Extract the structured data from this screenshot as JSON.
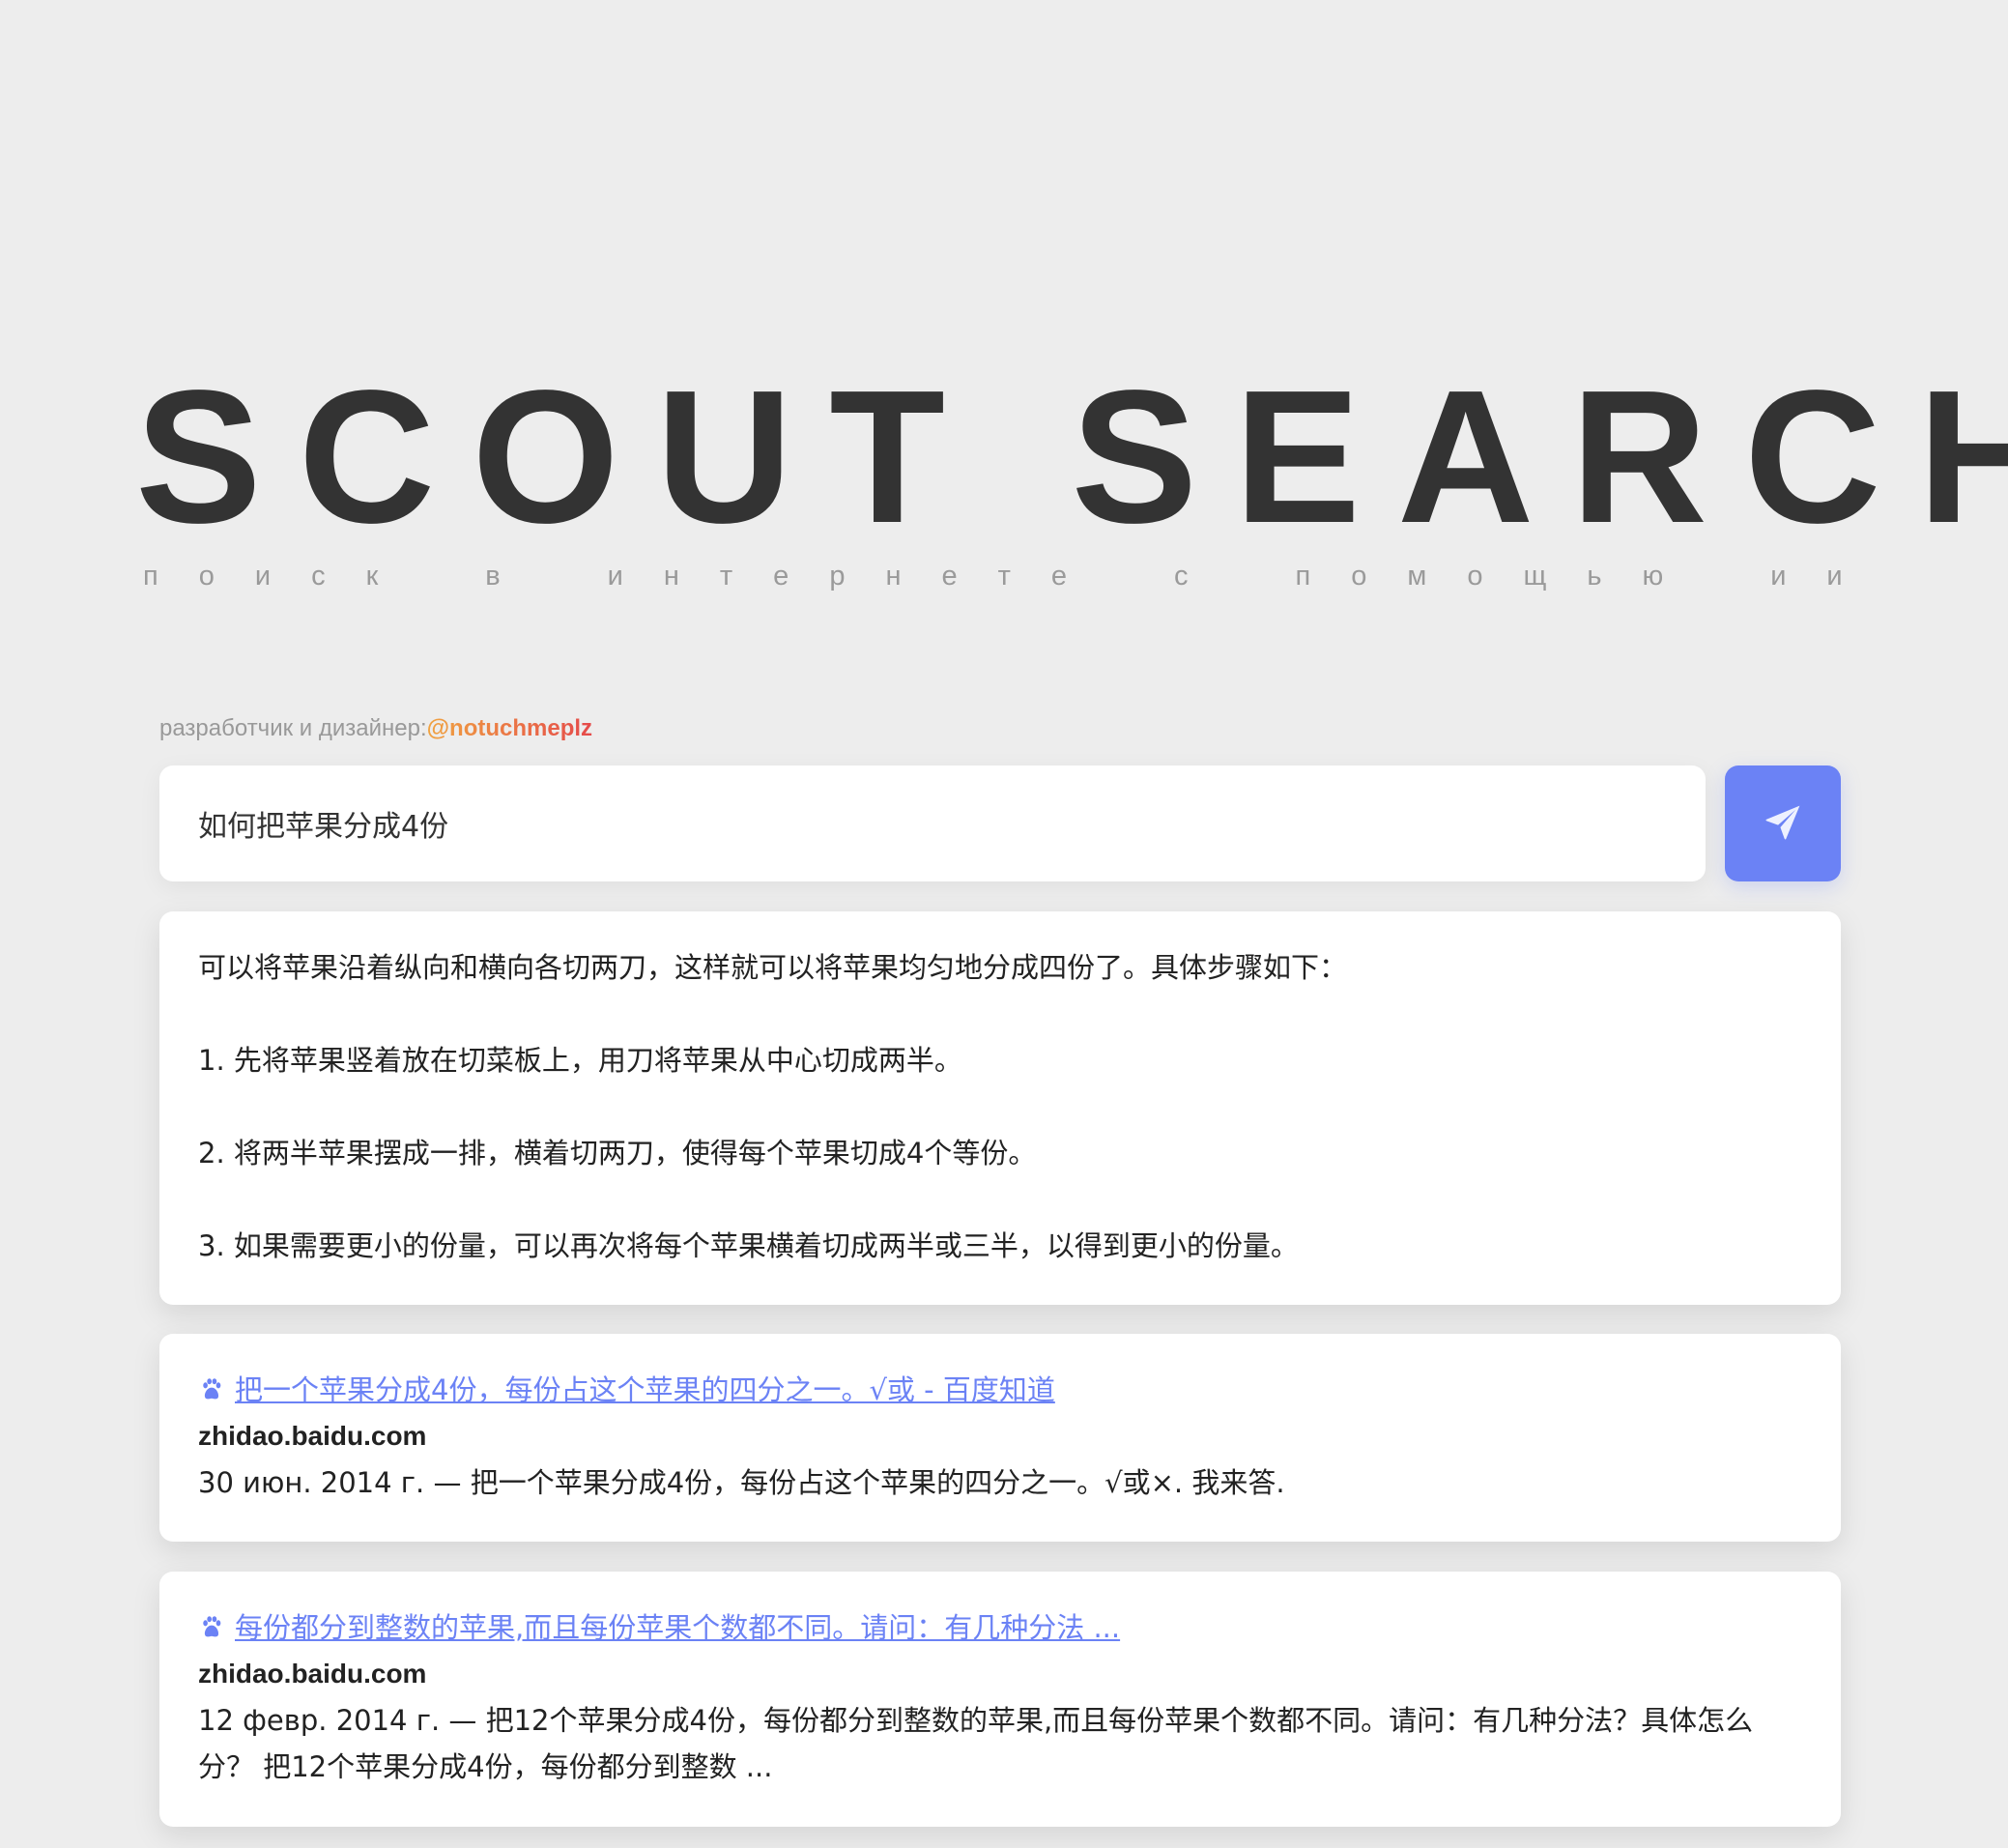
{
  "app": {
    "title": "SCOUT SEARCH",
    "subtitle_words": [
      "поиск",
      "в",
      "интернете",
      "с",
      "помощью",
      "ии"
    ]
  },
  "credit": {
    "label": "разработчик и дизайнер:",
    "handle": "@notuchmeplz"
  },
  "search": {
    "value": "如何把苹果分成4份",
    "placeholder": "",
    "button_icon": "send-icon"
  },
  "answer": {
    "lines": [
      "可以将苹果沿着纵向和横向各切两刀，这样就可以将苹果均匀地分成四份了。具体步骤如下：",
      "1. 先将苹果竖着放在切菜板上，用刀将苹果从中心切成两半。",
      "2. 将两半苹果摆成一排，横着切两刀，使得每个苹果切成4个等份。",
      "3. 如果需要更小的份量，可以再次将每个苹果横着切成两半或三半，以得到更小的份量。"
    ]
  },
  "results": [
    {
      "icon": "baidu-paw-icon",
      "title": "把一个苹果分成4份，每份占这个苹果的四分之一。√或 - 百度知道",
      "domain": "zhidao.baidu.com",
      "snippet": "30 июн. 2014 г. — 把一个苹果分成4份，每份占这个苹果的四分之一。√或×. 我来答."
    },
    {
      "icon": "baidu-paw-icon",
      "title": "每份都分到整数的苹果,而且每份苹果个数都不同。请问：有几种分法 ...",
      "domain": "zhidao.baidu.com",
      "snippet": "12 февр. 2014 г. — 把12个苹果分成4份，每份都分到整数的苹果,而且每份苹果个数都不同。请问：有几种分法？具体怎么分？ 把12个苹果分成4份，每份都分到整数 ..."
    }
  ],
  "colors": {
    "background": "#ededed",
    "accent": "#6b82f5",
    "title": "#333333",
    "handle_gradient_start": "#f0a341",
    "handle_gradient_end": "#e54a4a"
  }
}
